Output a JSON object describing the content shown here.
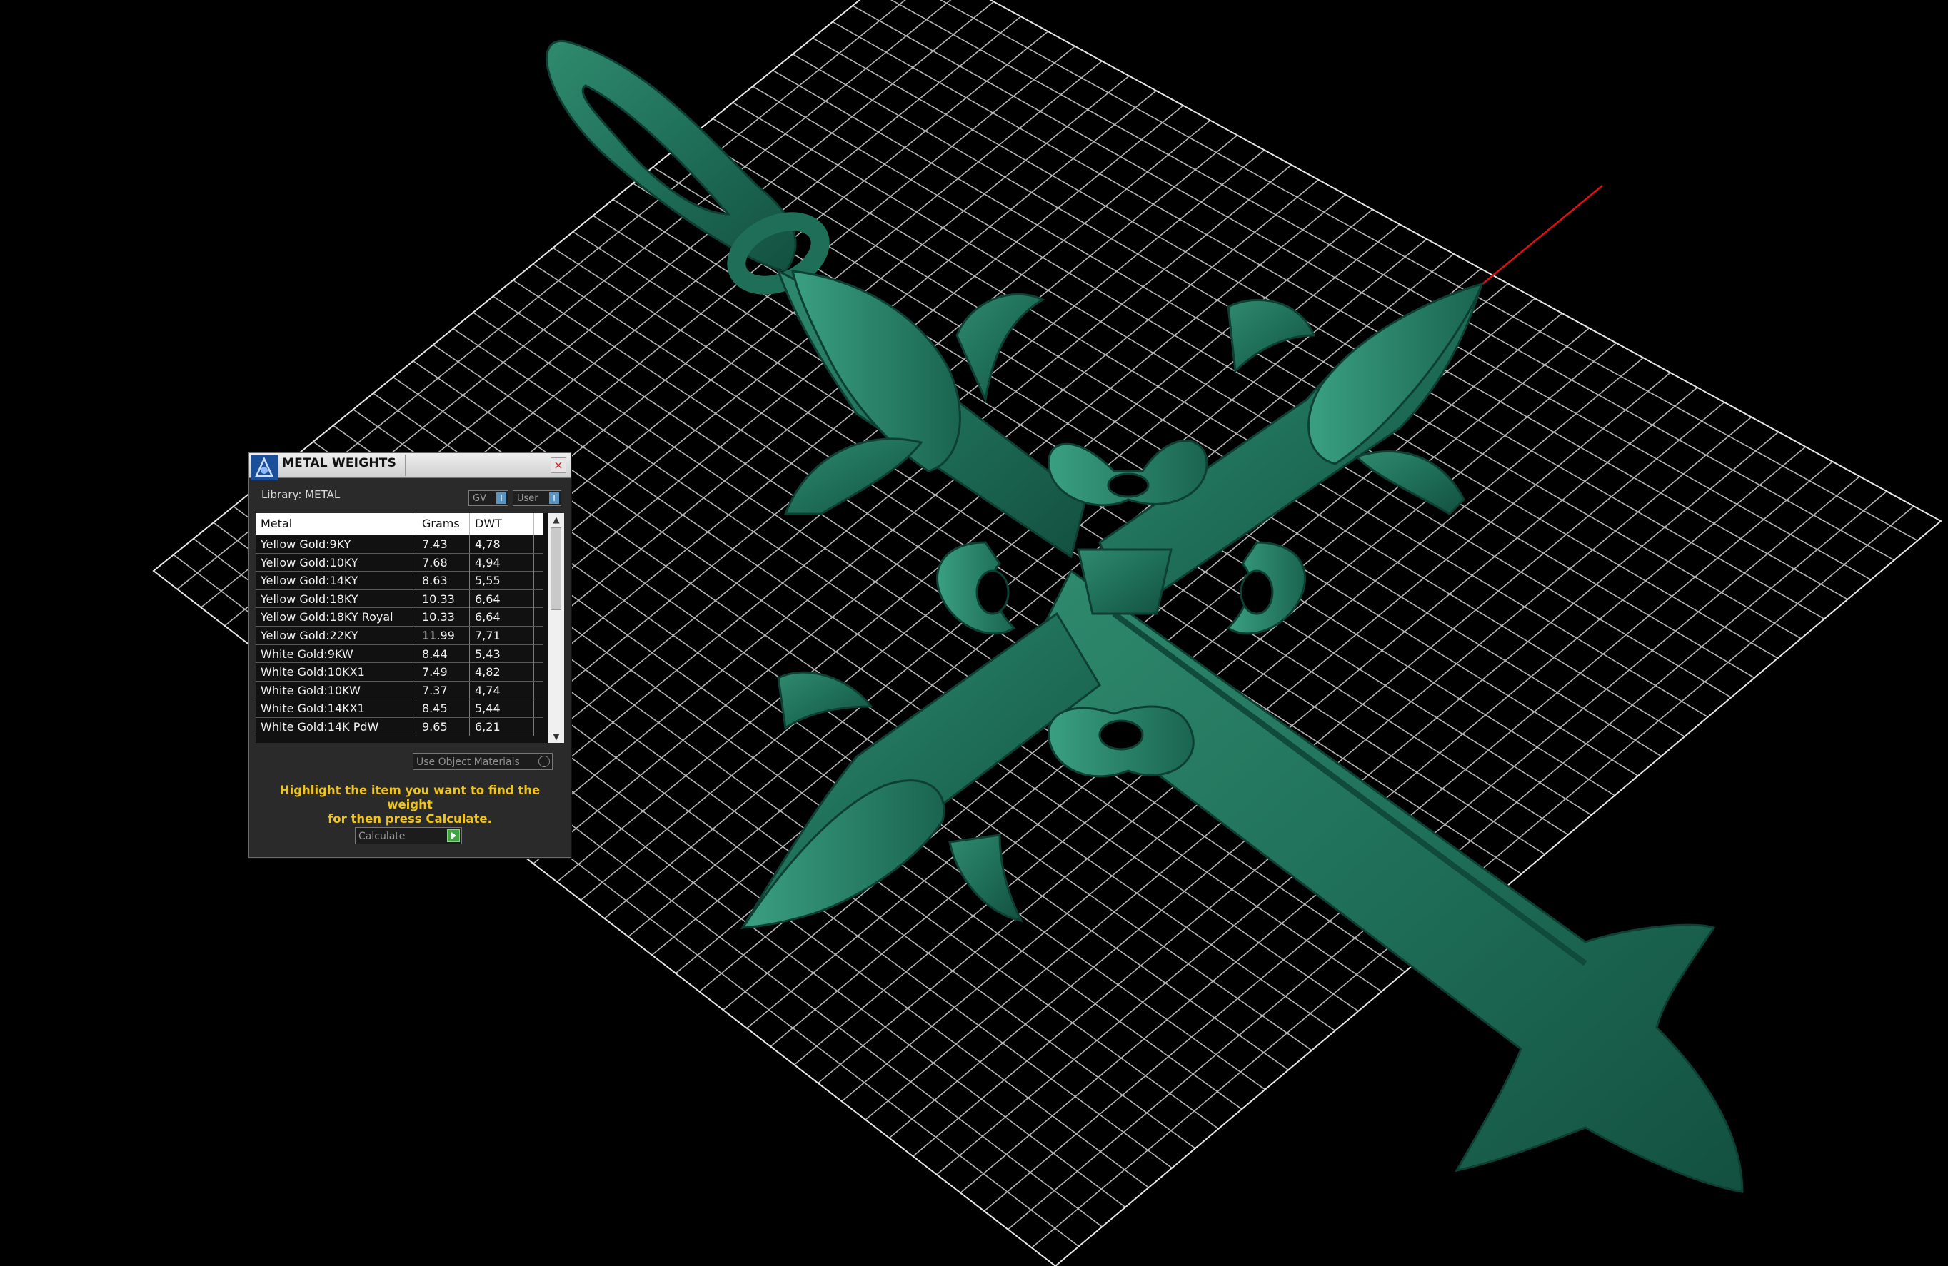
{
  "dialog": {
    "title": "METAL WEIGHTS",
    "close_symbol": "×",
    "library_label": "Library: METAL",
    "toggle_gv": {
      "label": "GV",
      "indicator": "I"
    },
    "toggle_user": {
      "label": "User",
      "indicator": "I"
    },
    "table": {
      "columns": [
        "Metal",
        "Grams",
        "DWT"
      ],
      "rows": [
        {
          "metal": "Yellow Gold:9KY",
          "grams": "7.43",
          "dwt": "4,78"
        },
        {
          "metal": "Yellow Gold:10KY",
          "grams": "7.68",
          "dwt": "4,94"
        },
        {
          "metal": "Yellow Gold:14KY",
          "grams": "8.63",
          "dwt": "5,55"
        },
        {
          "metal": "Yellow Gold:18KY",
          "grams": "10.33",
          "dwt": "6,64"
        },
        {
          "metal": "Yellow Gold:18KY Royal",
          "grams": "10.33",
          "dwt": "6,64"
        },
        {
          "metal": "Yellow Gold:22KY",
          "grams": "11.99",
          "dwt": "7,71"
        },
        {
          "metal": "White Gold:9KW",
          "grams": "8.44",
          "dwt": "5,43"
        },
        {
          "metal": "White Gold:10KX1",
          "grams": "7.49",
          "dwt": "4,82"
        },
        {
          "metal": "White Gold:10KW",
          "grams": "7.37",
          "dwt": "4,74"
        },
        {
          "metal": "White Gold:14KX1",
          "grams": "8.45",
          "dwt": "5,44"
        },
        {
          "metal": "White Gold:14K PdW",
          "grams": "9.65",
          "dwt": "6,21"
        }
      ]
    },
    "use_object_materials": "Use Object Materials",
    "hint_line1": "Highlight the item you want to find the weight",
    "hint_line2": "for then press Calculate.",
    "calculate_label": "Calculate"
  },
  "viewport": {
    "model_color": "#1f6f58",
    "grid_color": "#d8d8d8",
    "axis_color": "#e01010",
    "background": "#000000"
  }
}
